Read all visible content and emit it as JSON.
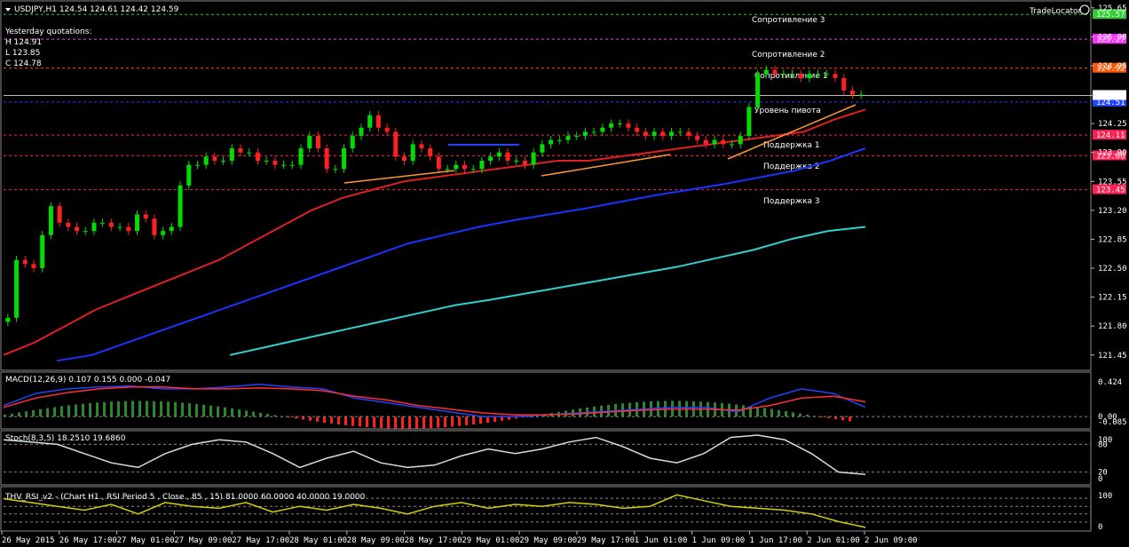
{
  "main": {
    "title": "USDJPY,H1  124.54 124.61 124.42 124.59",
    "brand": "TradeLocator",
    "yesterday": [
      "Yesterday quotations:",
      "H 124.91",
      "L 123.85",
      "C 124.78"
    ]
  },
  "chart_data": [
    {
      "type": "candlestick",
      "title": "USDJPY,H1  124.54 124.61 124.42 124.59",
      "ylim": [
        121.34,
        125.68
      ],
      "y_ticks": [
        "125.65",
        "125.30",
        "124.95",
        "124.59",
        "124.25",
        "123.90",
        "123.55",
        "123.20",
        "122.85",
        "122.50",
        "122.15",
        "121.80",
        "121.45"
      ],
      "x_ticks": [
        "26 May 2015",
        "26 May 17:00",
        "27 May 01:00",
        "27 May 09:00",
        "27 May 17:00",
        "28 May 01:00",
        "28 May 09:00",
        "28 May 17:00",
        "29 May 01:00",
        "29 May 09:00",
        "29 May 17:00",
        "1 Jun 01:00",
        "1 Jun 09:00",
        "1 Jun 17:00",
        "2 Jun 01:00",
        "2 Jun 09:00"
      ],
      "levels": [
        {
          "name": "Сопротивление 3",
          "value": 125.57,
          "label": "125.57",
          "color": "#33cc33"
        },
        {
          "name": "Сопротивление 2",
          "value": 125.27,
          "label": "125.27",
          "color": "#ff33ff"
        },
        {
          "name": "Сопротивление 1",
          "value": 124.92,
          "label": "124.92",
          "color": "#ff5500"
        },
        {
          "name": "Уровень пивота",
          "value": 124.51,
          "label": "124.51",
          "color": "#2244ff"
        },
        {
          "name": "Поддержка 1",
          "value": 124.11,
          "label": "124.11",
          "color": "#ff2255"
        },
        {
          "name": "Поддержка 2",
          "value": 123.86,
          "label": "123.86",
          "color": "#ff2255"
        },
        {
          "name": "Поддержка 3",
          "value": 123.45,
          "label": "123.45",
          "color": "#ff2255"
        }
      ],
      "current_price": {
        "value": 124.59,
        "label": "124.59"
      },
      "close": [
        121.9,
        122.6,
        122.55,
        122.5,
        122.9,
        123.25,
        123.05,
        123.0,
        122.95,
        122.95,
        123.05,
        123.05,
        123.0,
        123.0,
        122.95,
        123.15,
        123.1,
        122.9,
        122.95,
        123.0,
        123.5,
        123.75,
        123.75,
        123.85,
        123.8,
        123.8,
        123.95,
        123.9,
        123.9,
        123.8,
        123.8,
        123.75,
        123.75,
        123.75,
        123.95,
        124.1,
        123.95,
        123.7,
        123.7,
        123.95,
        124.1,
        124.2,
        124.35,
        124.2,
        124.15,
        123.85,
        123.8,
        124.0,
        123.95,
        123.85,
        123.7,
        123.7,
        123.75,
        123.7,
        123.7,
        123.8,
        123.85,
        123.9,
        123.8,
        123.8,
        123.75,
        123.9,
        124.0,
        124.05,
        124.05,
        124.1,
        124.1,
        124.15,
        124.15,
        124.2,
        124.25,
        124.25,
        124.2,
        124.15,
        124.1,
        124.15,
        124.1,
        124.15,
        124.15,
        124.1,
        124.05,
        124.0,
        124.05,
        124.0,
        124.0,
        124.1,
        124.45,
        124.85,
        124.9,
        124.85,
        124.85,
        124.85,
        124.8,
        124.85,
        124.85,
        124.85,
        124.8,
        124.65,
        124.6,
        124.6
      ],
      "ma_series": [
        {
          "color": "#e02020",
          "values": [
            121.45,
            121.6,
            121.8,
            122.0,
            122.15,
            122.3,
            122.45,
            122.6,
            122.8,
            123.0,
            123.2,
            123.35,
            123.45,
            123.55,
            123.6,
            123.65,
            123.7,
            123.75,
            123.8,
            123.8,
            123.85,
            123.9,
            123.95,
            124.0,
            124.05,
            124.1,
            124.15,
            124.3,
            124.42
          ]
        },
        {
          "color": "#1a33ff",
          "values": [
            121.38,
            121.45,
            121.6,
            121.75,
            121.9,
            122.05,
            122.2,
            122.35,
            122.5,
            122.65,
            122.8,
            122.9,
            123.0,
            123.08,
            123.15,
            123.22,
            123.3,
            123.38,
            123.45,
            123.52,
            123.6,
            123.68,
            123.8,
            123.95
          ]
        },
        {
          "color": "#30d0d0",
          "values": [
            121.45,
            121.55,
            121.65,
            121.75,
            121.85,
            121.95,
            122.05,
            122.12,
            122.2,
            122.28,
            122.36,
            122.44,
            122.52,
            122.62,
            122.72,
            122.85,
            122.95,
            123.0
          ]
        }
      ]
    },
    {
      "type": "line",
      "title": "MACD(12,26,9) 0.107 0.155 0.000 -0.047",
      "y_ticks": [
        "0.424",
        "0.00",
        "-0.085"
      ],
      "series": [
        {
          "color": "#2244ff",
          "values": [
            0.12,
            0.25,
            0.3,
            0.32,
            0.33,
            0.3,
            0.3,
            0.32,
            0.35,
            0.32,
            0.3,
            0.2,
            0.15,
            0.1,
            0.05,
            0.0,
            0.0,
            0.02,
            0.04,
            0.06,
            0.08,
            0.1,
            0.1,
            0.05,
            0.2,
            0.3,
            0.25,
            0.1
          ]
        },
        {
          "color": "#ff3030",
          "values": [
            0.1,
            0.2,
            0.26,
            0.3,
            0.32,
            0.32,
            0.3,
            0.3,
            0.31,
            0.3,
            0.28,
            0.22,
            0.18,
            0.12,
            0.08,
            0.04,
            0.02,
            0.02,
            0.03,
            0.05,
            0.07,
            0.08,
            0.08,
            0.07,
            0.12,
            0.2,
            0.22,
            0.16
          ]
        }
      ]
    },
    {
      "type": "line",
      "title": "Stoch(8,3,5) 18.2510 19.6860",
      "y_ticks": [
        "100",
        "80",
        "20",
        "0"
      ],
      "series": [
        {
          "color": "#d0e0e0",
          "values": [
            90,
            85,
            80,
            60,
            40,
            30,
            60,
            80,
            90,
            85,
            60,
            30,
            50,
            65,
            40,
            30,
            35,
            55,
            70,
            60,
            70,
            85,
            95,
            75,
            50,
            40,
            60,
            95,
            100,
            90,
            60,
            20,
            15
          ]
        }
      ]
    },
    {
      "type": "line",
      "title": "THV_RSI_v2 - (Chart H1 , RSI Period 5 , Close , 85 , 15)  81.0000 60.0000 40.0000 19.0000",
      "y_ticks": [
        "100",
        "0"
      ],
      "series": [
        {
          "color": "#d0d000",
          "values": [
            80,
            70,
            60,
            50,
            65,
            40,
            70,
            60,
            55,
            70,
            45,
            60,
            50,
            65,
            55,
            40,
            60,
            70,
            55,
            65,
            60,
            70,
            65,
            55,
            60,
            90,
            75,
            60,
            55,
            50,
            40,
            20,
            5
          ]
        }
      ]
    }
  ]
}
